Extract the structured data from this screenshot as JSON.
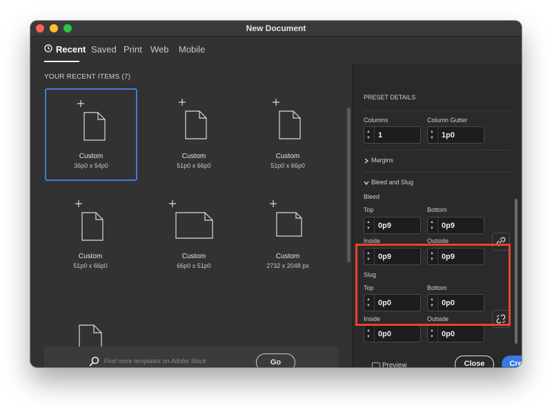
{
  "window": {
    "title": "New Document"
  },
  "tabs": [
    {
      "label": "Recent"
    },
    {
      "label": "Saved"
    },
    {
      "label": "Print"
    },
    {
      "label": "Web"
    },
    {
      "label": "Mobile"
    }
  ],
  "recent": {
    "header": "YOUR RECENT ITEMS  (7)",
    "items": [
      {
        "name": "Custom",
        "size": "36p0 x 54p0"
      },
      {
        "name": "Custom",
        "size": "51p0 x 66p0"
      },
      {
        "name": "Custom",
        "size": "51p0 x 66p0"
      },
      {
        "name": "Custom",
        "size": "51p0 x 66p0"
      },
      {
        "name": "Custom",
        "size": "66p0 x 51p0"
      },
      {
        "name": "Custom",
        "size": "2732 x 2048 px"
      }
    ]
  },
  "stock": {
    "placeholder": "Find more templates on Adobe Stock",
    "go_label": "Go"
  },
  "preset": {
    "header": "PRESET DETAILS",
    "columns_label": "Columns",
    "columns_value": "1",
    "gutter_label": "Column Gutter",
    "gutter_value": "1p0",
    "margins_label": "Margins",
    "bleed_slug_label": "Bleed and Slug",
    "bleed": {
      "label": "Bleed",
      "top_label": "Top",
      "top": "0p9",
      "bottom_label": "Bottom",
      "bottom": "0p9",
      "inside_label": "Inside",
      "inside": "0p9",
      "outside_label": "Outside",
      "outside": "0p9"
    },
    "slug": {
      "label": "Slug",
      "top_label": "Top",
      "top": "0p0",
      "bottom_label": "Bottom",
      "bottom": "0p0",
      "inside_label": "Inside",
      "inside": "0p0",
      "outside_label": "Outside",
      "outside": "0p0"
    }
  },
  "footer": {
    "preview_label": "Preview",
    "close_label": "Close",
    "create_label": "Create"
  },
  "colors": {
    "accent": "#3a7ae0",
    "highlight": "#e8442e",
    "selected_border": "#3d7fdb"
  },
  "icons": [
    "clock-icon",
    "search-icon",
    "link-icon",
    "broken-link-icon",
    "chevron-right-icon",
    "chevron-down-icon"
  ]
}
